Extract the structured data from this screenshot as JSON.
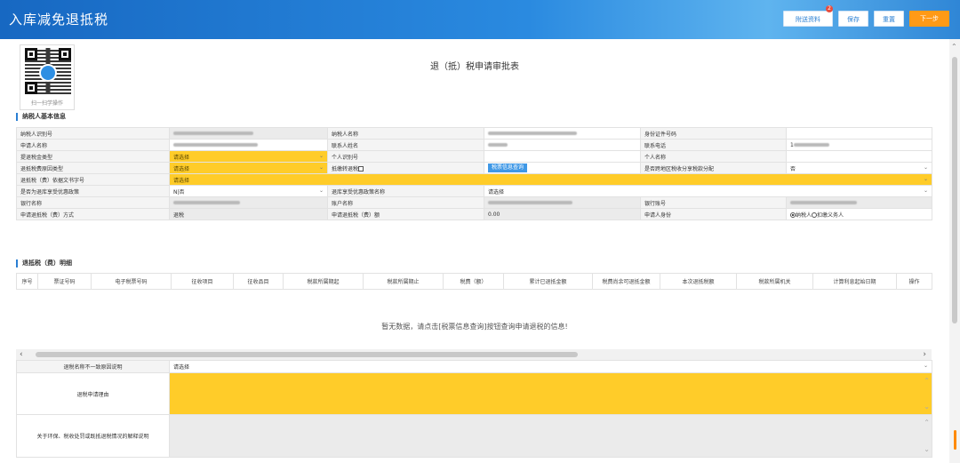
{
  "app": {
    "title": "入库减免退抵税"
  },
  "toolbar": {
    "attachments_label": "附送资料",
    "attachments_badge": "2",
    "save_label": "保存",
    "reset_label": "重置",
    "next_label": "下一步"
  },
  "qr": {
    "caption": "扫一扫学操作"
  },
  "form": {
    "title": "退（抵）税申请审批表"
  },
  "basic": {
    "section_title": "纳税人基本信息",
    "labels": {
      "taxpayer_id": "纳税人识别号",
      "taxpayer_name": "纳税人名称",
      "id_number": "身份证件号码",
      "applicant_name": "申请人名称",
      "contact_name": "联系人姓名",
      "contact_phone": "联系电话",
      "refund_type": "提退税金类型",
      "personal_id": "个人识别号",
      "personal_name": "个人名称",
      "reason_type": "退抵税费原因类型",
      "offset_tax": "抵缴转退税",
      "cross_region": "是否跨地区税收分享税款分配",
      "basis_doc": "退抵税（费）依据文书字号",
      "high_tech": "是否为退库享受优惠政策",
      "policy_name": "退库享受优惠政策名称",
      "bank_name": "银行名称",
      "account_name": "账户名称",
      "bank_account": "银行账号",
      "refund_method": "申请退抵税（费）方式",
      "refund_amount": "申请退抵税（费）额",
      "applicant_identity": "申请人身份"
    },
    "values": {
      "contact_phone_prefix": "1",
      "refund_type": "请选择",
      "reason_type": "请选择",
      "query_button": "税票信息查询",
      "cross_region": "否",
      "basis_doc": "请选择",
      "high_tech": "N|否",
      "policy_name": "请选择",
      "refund_method": "退税",
      "refund_amount": "0.00",
      "identity_option_1": "纳税人",
      "identity_option_2": "扣缴义务人"
    }
  },
  "detail": {
    "section_title": "退抵税（费）明细",
    "columns": [
      "序号",
      "票证号码",
      "电子税票号码",
      "征收项目",
      "征收品目",
      "税款所属期起",
      "税款所属期止",
      "税费（额）",
      "累计已退抵金额",
      "税费尚余可退抵金额",
      "本次退抵税额",
      "税款所属机关",
      "计算利息起始日期",
      "操作"
    ],
    "empty_message": "暂无数据，请点击[税票信息查询]按钮查询申请退税的信息!"
  },
  "bottom": {
    "mismatch_label": "退税名称不一致原因说明",
    "mismatch_value": "请选择",
    "reason_label": "退税申请理由",
    "env_label": "关于环保、税收处罚或既抵退税情况的解释说明"
  },
  "colors": {
    "accent": "#2a7fd3",
    "yellow": "#ffcc29",
    "orange": "#ff9a16"
  }
}
